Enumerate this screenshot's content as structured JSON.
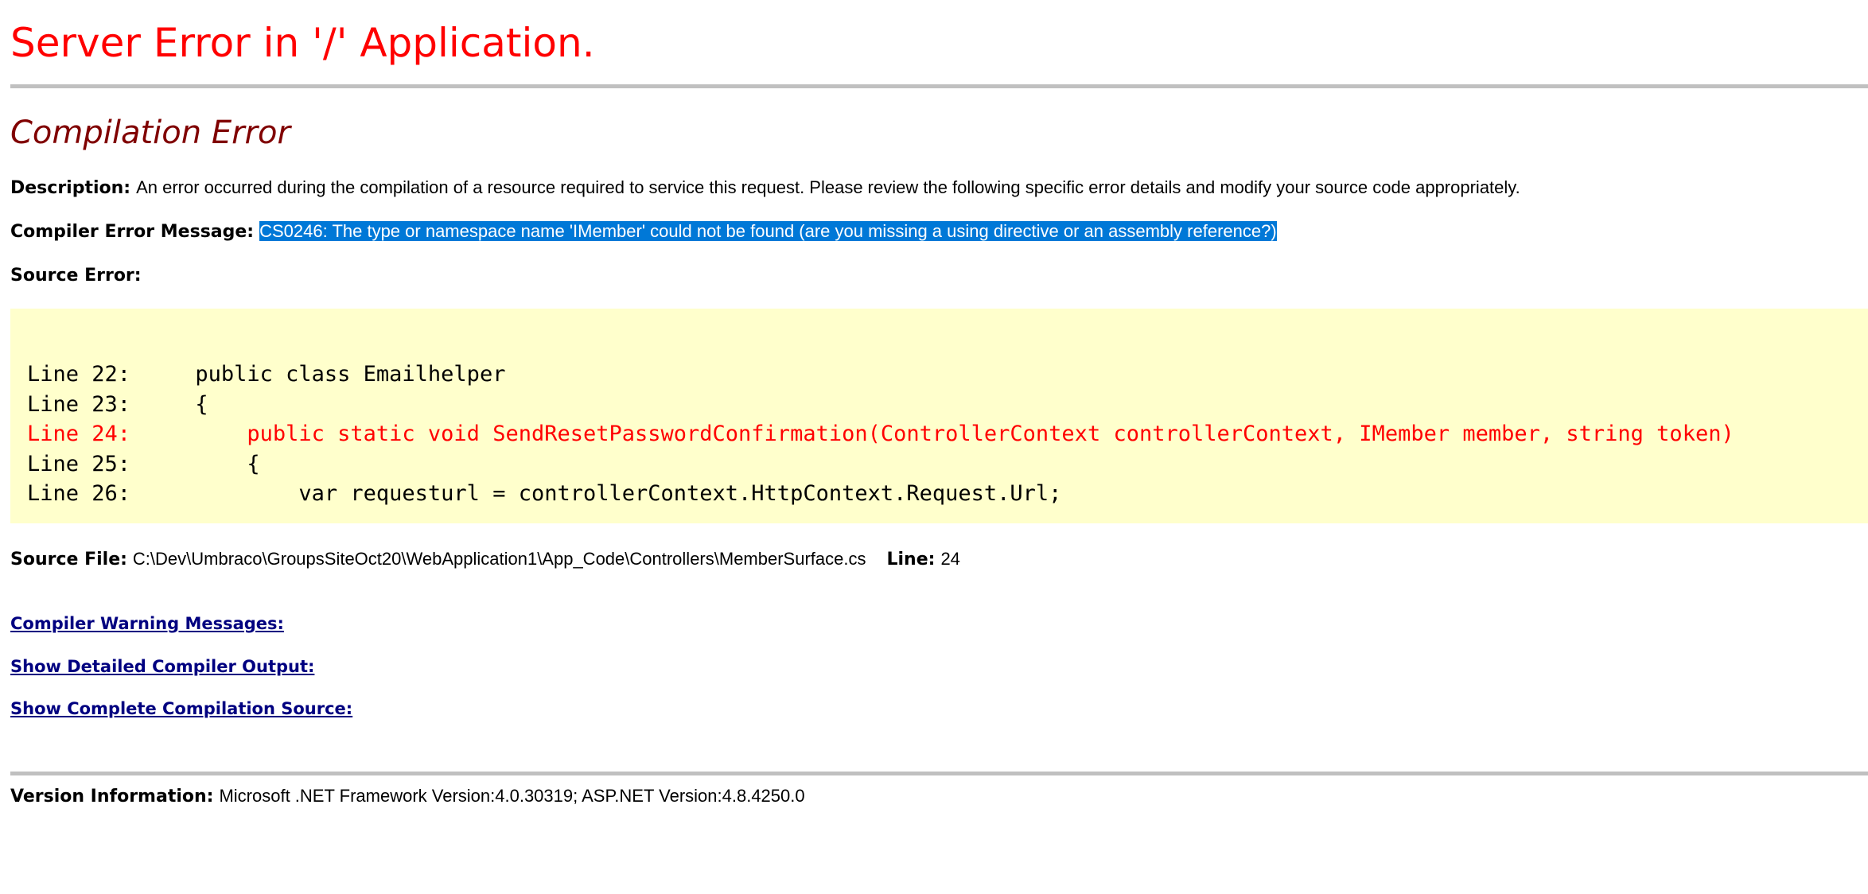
{
  "page": {
    "title": "Server Error in '/' Application.",
    "subtitle": "Compilation Error"
  },
  "description": {
    "label": "Description:",
    "text": "An error occurred during the compilation of a resource required to service this request. Please review the following specific error details and modify your source code appropriately."
  },
  "compiler_error": {
    "label": "Compiler Error Message:",
    "text": "CS0246: The type or namespace name 'IMember' could not be found (are you missing a using directive or an assembly reference?)"
  },
  "source_error": {
    "label": "Source Error:",
    "lines": [
      {
        "text": "Line 22:     public class Emailhelper",
        "error": false
      },
      {
        "text": "Line 23:     {",
        "error": false
      },
      {
        "text": "Line 24:         public static void SendResetPasswordConfirmation(ControllerContext controllerContext, IMember member, string token)",
        "error": true
      },
      {
        "text": "Line 25:         {",
        "error": false
      },
      {
        "text": "Line 26:             var requesturl = controllerContext.HttpContext.Request.Url;",
        "error": false
      }
    ]
  },
  "source_file": {
    "label": "Source File:",
    "path": "C:\\Dev\\Umbraco\\GroupsSiteOct20\\WebApplication1\\App_Code\\Controllers\\MemberSurface.cs",
    "line_label": "Line:",
    "line_number": "24"
  },
  "links": {
    "warnings": "Compiler Warning Messages:",
    "detailed_output": "Show Detailed Compiler Output:",
    "complete_source": "Show Complete Compilation Source:"
  },
  "version": {
    "label": "Version Information:",
    "text": "Microsoft .NET Framework Version:4.0.30319; ASP.NET Version:4.8.4250.0"
  },
  "colors": {
    "title": "#ff0000",
    "subtitle": "#800000",
    "link": "#000080",
    "code_background": "#ffffcc",
    "selection": "#0078d7",
    "rule": "#c0c0c0"
  }
}
